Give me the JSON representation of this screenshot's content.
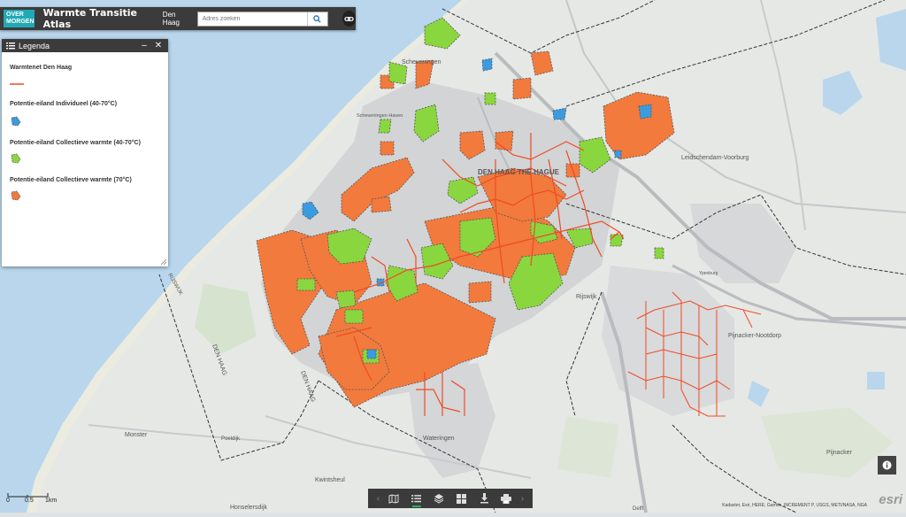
{
  "header": {
    "logo_line1": "OVER",
    "logo_line2": "MORGEN",
    "app_title": "Warmte Transitie Atlas",
    "region": "Den Haag",
    "search_placeholder": "Adres zoeken",
    "search_icon": "search-icon",
    "link_icon": "link-icon"
  },
  "legend": {
    "title": "Legenda",
    "minimize": "–",
    "close": "✕",
    "items": [
      {
        "label": "Warmtenet Den Haag",
        "symbol": "line",
        "color": "#f04a24"
      },
      {
        "label": "Potentie-eiland Individueel (40-70°C)",
        "symbol": "polygon",
        "color": "#3a9be0"
      },
      {
        "label": "Potentie-eiland Collectieve warmte (40-70°C)",
        "symbol": "polygon",
        "color": "#8ad63e"
      },
      {
        "label": "Potentie-eiland Collectieve warmte (70°C)",
        "symbol": "polygon",
        "color": "#f27a3c"
      }
    ]
  },
  "map_labels": {
    "scheveningen": "Scheveningen",
    "scheveningen_haven": "Scheveningen Haven",
    "den_haag_city": "DEN HAAG THE HAGUE",
    "leidschendam": "Leidschendam-Voorburg",
    "rijswijk": "Rijswijk",
    "pijnacker_nootdorp": "Pijnacker-Nootdorp",
    "pijnacker": "Pijnacker",
    "wateringen": "Wateringen",
    "monster": "Monster",
    "poeldijk": "Poeldijk",
    "kwintsheul": "Kwintsheul",
    "honselersdijk": "Honselersdijk",
    "delft": "Delft",
    "den_haag_border": "DEN HAAG",
    "ypenburg": "Ypenburg",
    "rijswijk_border": "RIJSWIJK"
  },
  "toolbar": {
    "buttons": [
      "map-icon",
      "list-icon",
      "layers-icon",
      "grid-icon",
      "download-icon",
      "print-icon"
    ],
    "active": "list-icon"
  },
  "scale": {
    "ticks": [
      "0",
      "0.5",
      "1km"
    ]
  },
  "attribution": "Kadaster, Esri, HERE, Garmin, INCREMENT P, USGS, METI/NASA, NGA",
  "esri_logo": "esri",
  "colors": {
    "header": "#3b3b3b",
    "brand": "#20a9b5",
    "heat_line": "#f04a24",
    "blue": "#3a9be0",
    "green": "#8ad63e",
    "orange": "#f27a3c"
  }
}
